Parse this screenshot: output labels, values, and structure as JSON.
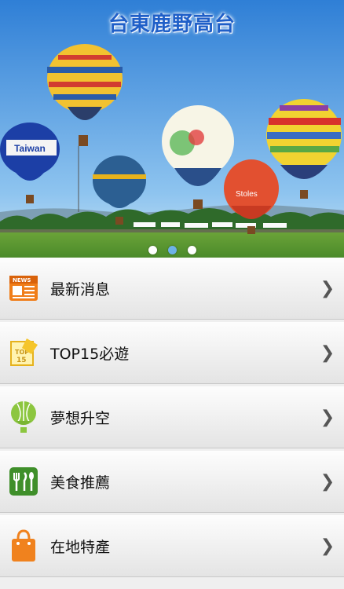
{
  "header": {
    "title": "台東鹿野高台"
  },
  "banner": {
    "balloon_text_1": "Taiwan",
    "balloon_text_2": "Stoles"
  },
  "menu": {
    "items": [
      {
        "label": "最新消息",
        "icon": "news-icon"
      },
      {
        "label": "TOP15必遊",
        "icon": "top15-icon"
      },
      {
        "label": "夢想升空",
        "icon": "hot-air-balloon-icon"
      },
      {
        "label": "美食推薦",
        "icon": "fork-knife-icon"
      },
      {
        "label": "在地特產",
        "icon": "shopping-bag-icon"
      }
    ]
  },
  "carousel": {
    "page_count": 3,
    "active_index": 1
  },
  "colors": {
    "title": "#1f5fc8",
    "news_orange": "#f07d18",
    "food_green": "#3f8f2a",
    "bag_orange": "#f0821e",
    "balloon_green": "#8cc63f"
  }
}
